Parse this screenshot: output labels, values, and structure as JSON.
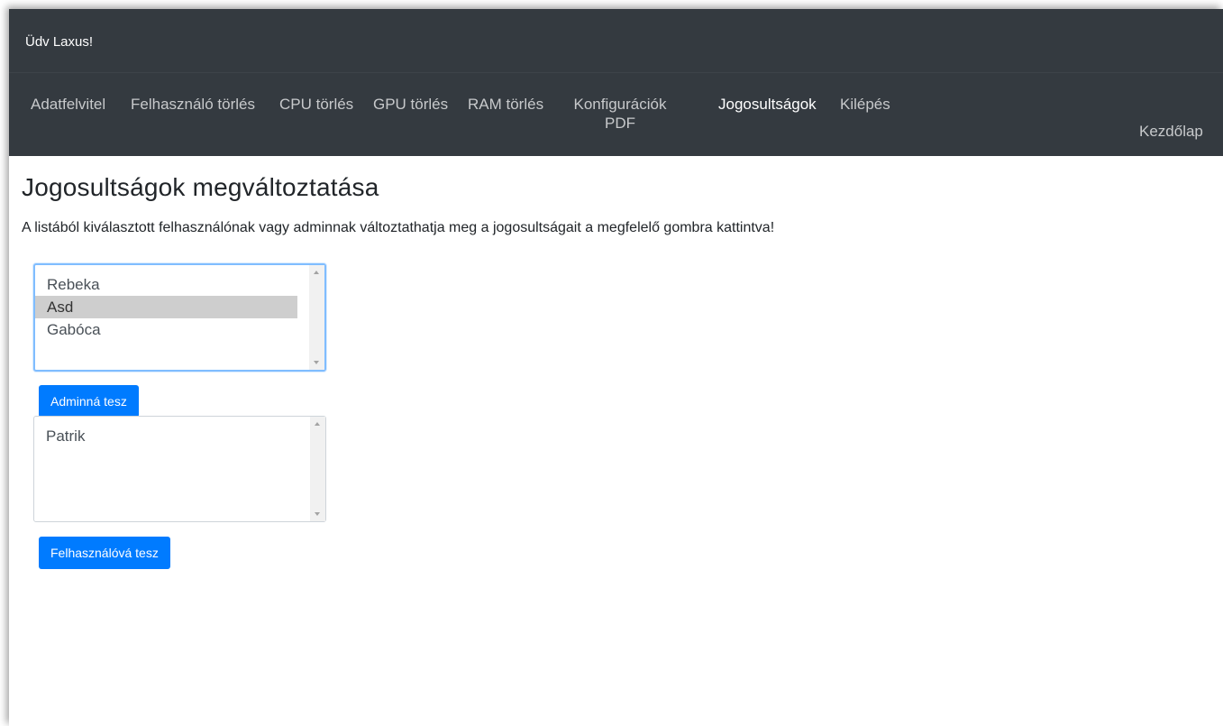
{
  "header": {
    "greeting": "Üdv Laxus!"
  },
  "nav": {
    "items": [
      {
        "label": "Adatfelvitel"
      },
      {
        "label": "Felhasználó törlés"
      },
      {
        "label": "CPU törlés"
      },
      {
        "label": "GPU törlés"
      },
      {
        "label": "RAM törlés"
      },
      {
        "label": "Konfigurációk PDF"
      },
      {
        "label": "Jogosultságok"
      },
      {
        "label": "Kilépés"
      },
      {
        "label": "Kezdőlap"
      }
    ],
    "active": "Jogosultságok"
  },
  "page": {
    "title": "Jogosultságok megváltoztatása",
    "description": "A listából kiválasztott felhasználónak vagy adminnak változtathatja meg a jogosultságait a megfelelő gombra kattintva!"
  },
  "users_list": {
    "items": [
      "Rebeka",
      "Asd",
      "Gabóca"
    ],
    "selected": "Asd",
    "button_label": "Adminná tesz"
  },
  "admins_list": {
    "items": [
      "Patrik"
    ],
    "button_label": "Felhasználóvá tesz"
  },
  "colors": {
    "navbar": "#343a40",
    "primary": "#007bff",
    "selection": "#cecece"
  }
}
